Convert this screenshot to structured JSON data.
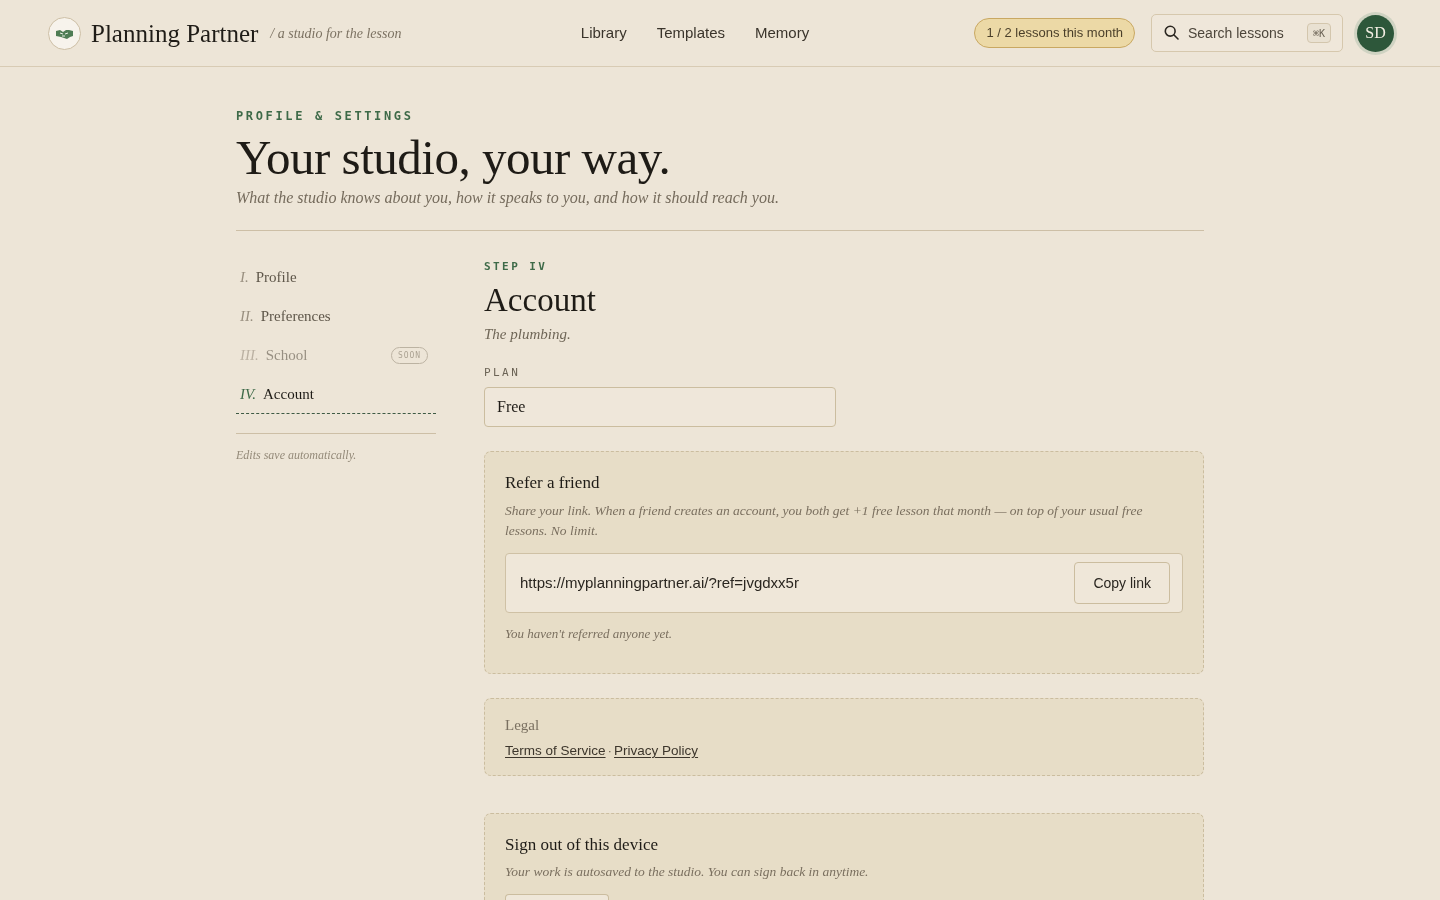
{
  "header": {
    "brand": "Planning Partner",
    "tagline": "/ a studio for the lesson",
    "nav": [
      {
        "label": "Library"
      },
      {
        "label": "Templates"
      },
      {
        "label": "Memory"
      }
    ],
    "usage_badge": "1 / 2 lessons this month",
    "search": {
      "placeholder": "Search lessons",
      "shortcut": "⌘K"
    },
    "avatar": "SD"
  },
  "page": {
    "eyebrow": "PROFILE & SETTINGS",
    "title": "Your studio, your way.",
    "subtitle": "What the studio knows about you, how it speaks to you, and how it should reach you."
  },
  "sidebar": {
    "items": [
      {
        "numeral": "I.",
        "label": "Profile",
        "selected": false,
        "disabled": false
      },
      {
        "numeral": "II.",
        "label": "Preferences",
        "selected": false,
        "disabled": false
      },
      {
        "numeral": "III.",
        "label": "School",
        "selected": false,
        "disabled": true,
        "badge": "SOON"
      },
      {
        "numeral": "IV.",
        "label": "Account",
        "selected": true,
        "disabled": false
      }
    ],
    "note": "Edits save automatically."
  },
  "section": {
    "step": "STEP IV",
    "title": "Account",
    "subtitle": "The plumbing.",
    "plan": {
      "label": "PLAN",
      "value": "Free"
    },
    "cards": [
      {
        "kind": "referral",
        "title": "Refer a friend",
        "description": "Share your link. When a friend creates an account, you both get +1 free lesson that month — on top of your usual free lessons. No limit.",
        "link": "https://myplanningpartner.ai/?ref=jvgdxx5r",
        "button": "Copy link",
        "status": "You haven't referred anyone yet."
      },
      {
        "kind": "links",
        "title": "Legal",
        "links": [
          "Terms of Service",
          "Privacy Policy"
        ],
        "separator": "·"
      },
      {
        "kind": "action",
        "title": "Sign out of this device",
        "description": "Your work is autosaved to the studio. You can sign back in anytime."
      }
    ]
  }
}
